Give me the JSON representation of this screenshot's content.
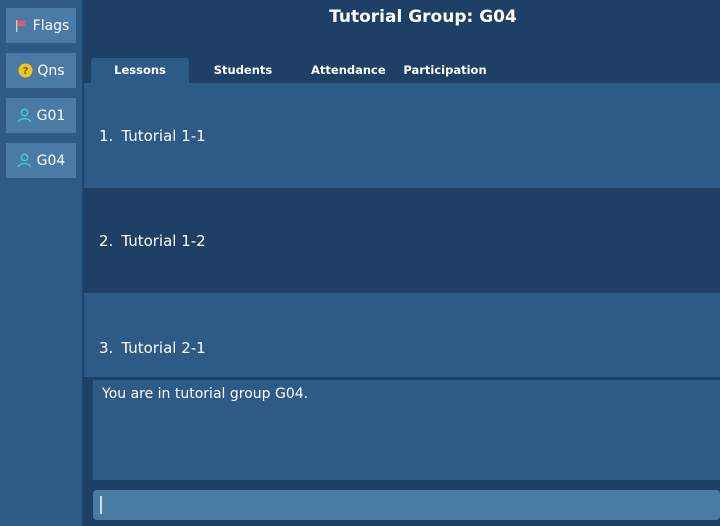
{
  "sidebar": {
    "items": [
      {
        "label": "Flags",
        "icon": "flag-icon",
        "icon_color": "#e05a6a"
      },
      {
        "label": "Qns",
        "icon": "question-icon",
        "icon_color": "#f5c518"
      },
      {
        "label": "G01",
        "icon": "person-icon",
        "icon_color": "#3fd0d8"
      },
      {
        "label": "G04",
        "icon": "person-icon",
        "icon_color": "#3fd0d8"
      }
    ]
  },
  "header": {
    "title": "Tutorial Group: G04"
  },
  "tabs": [
    {
      "label": "Lessons",
      "active": true
    },
    {
      "label": "Students",
      "active": false
    },
    {
      "label": "Attendance",
      "active": false
    },
    {
      "label": "Participation",
      "active": false
    }
  ],
  "lessons": [
    {
      "number": "1.",
      "name": "Tutorial 1-1"
    },
    {
      "number": "2.",
      "name": "Tutorial 1-2"
    },
    {
      "number": "3.",
      "name": "Tutorial 2-1"
    }
  ],
  "output": {
    "message": "You are in tutorial group G04."
  },
  "command": {
    "value": "",
    "placeholder": ""
  },
  "colors": {
    "background": "#1e3f66",
    "panel": "#2d5a87",
    "button": "#4a7ba7"
  }
}
